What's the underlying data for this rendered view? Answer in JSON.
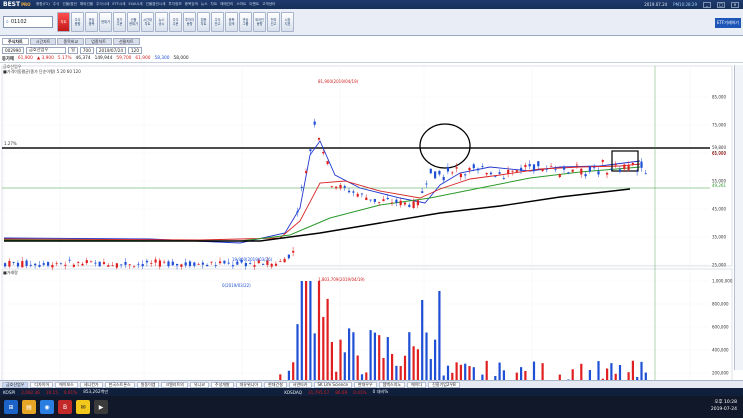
{
  "titlebar": {
    "logo": "BEST",
    "logo_sub": "PRO",
    "menu": [
      "종합(F2)",
      "주식",
      "선물/옵션",
      "해외선물",
      "주식시세",
      "ETF시세",
      "ELW시세",
      "선물옵션시세",
      "투자정보",
      "종목검색",
      "뉴스",
      "차트",
      "매매관리",
      "스마트",
      "이벤트",
      "고객센터"
    ],
    "date": "2019.07.24",
    "timer": "PM10:28:29"
  },
  "toolbar": {
    "search_value": "01102",
    "buttons": [
      "차트",
      "주식 종합",
      "관심 종목",
      "현재가",
      "호가 주문",
      "선물 현재가",
      "시간대 차트",
      "뉴스 공시",
      "주식 주문",
      "투자자 동향",
      "업종 차트",
      "주식 잔고",
      "종목 검색",
      "관심 그룹",
      "외국인 동향",
      "전자 신고",
      "시장 지표"
    ],
    "etf_label": "ETF거래하기"
  },
  "tabs": [
    "주식차트",
    "시간차트",
    "종목비교",
    "업종차트",
    "선물차트"
  ],
  "coderow": {
    "code": "002990",
    "name": "금호산업우",
    "interval": "일",
    "date": "2019/07/24",
    "count": "120",
    "count2": "700"
  },
  "pricerow": {
    "label": "등가매",
    "price": "61,900",
    "change": "3,900",
    "rate": "5.17%",
    "volume": "46,374",
    "amount": "149,944",
    "open": "59,700",
    "high": "61,900",
    "low": "58,300",
    "prev": "58,000"
  },
  "chart_label": "금호산업우",
  "indicator_label": "■가격이동평균(종가 단순이평) 5 20 60 120",
  "volume_label": "■거래량",
  "chart_data": {
    "type": "candlestick",
    "price_ticks": [
      "85,000",
      "75,000",
      "65,000",
      "55,000",
      "45,000",
      "35,000",
      "25,000"
    ],
    "volume_ticks": [
      "1,000,000",
      "800,000",
      "600,000",
      "400,000",
      "200,000"
    ],
    "x_ticks": [
      "2019/01/18",
      "02",
      "03",
      "04",
      "05",
      "06",
      "07",
      "2019/07/24"
    ],
    "annotations": {
      "high": "81,900(2019/04/19)",
      "low": "19,900(2019/03/26)",
      "vol_high": "1,803,709(2019/04/19)",
      "vol_low": "0(2019/03/22)"
    },
    "right_labels": {
      "pct": "1.27%",
      "current": "61,900",
      "ma": "59,800",
      "green": "49,261",
      "vol_current": "20,060"
    },
    "bottom_right": "2019/07/24(수)"
  },
  "bottom_tabs": [
    "금호산업우",
    "디자이어",
    "에이보스",
    "세니컨가",
    "한국스트론스",
    "원동이엠",
    "크엘리트의",
    "유니코",
    "주성개발",
    "대유위니아",
    "현대건설",
    "서연타카",
    "SK Life Science",
    "현대우우",
    "젬백스지노",
    "에이다",
    "진흥기업2우B"
  ],
  "ticker": {
    "kospi_label": "KOSPI",
    "kospi_value": "2,092.36",
    "kospi_change": "19.15",
    "kospi_rate": "0.91%",
    "kospi_amount": "853,262백만",
    "kosdaq_label": "KOSDAQ",
    "kosdaq_value": "31,795.57",
    "kosdaq_change": "86.69",
    "kosdaq_rate": "0.41%",
    "balance": "0 대비%"
  },
  "clock": {
    "time": "오후 10:28",
    "date": "2019-07-24"
  }
}
